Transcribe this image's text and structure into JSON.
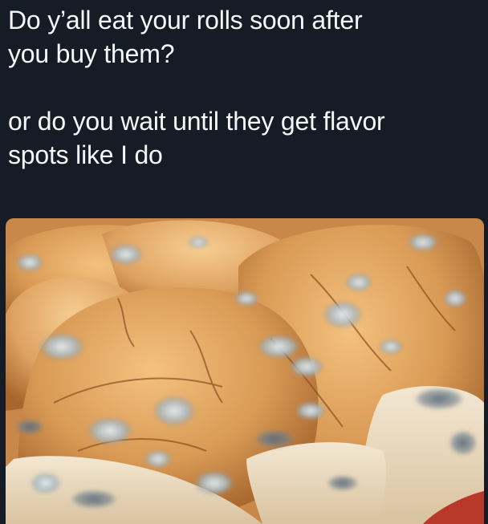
{
  "post": {
    "line1": "Do y’all eat your rolls soon after",
    "line2": "you buy them?",
    "line3": "or do you wait until they get flavor",
    "line4": "spots like I do"
  },
  "image": {
    "description_icon": "moldy-rolls-photo",
    "colors": {
      "background": "#151c26",
      "text": "#f5f7f9",
      "crust": "#d99a55",
      "crumb": "#efe0c6",
      "mold": "#9fb1bd"
    }
  }
}
